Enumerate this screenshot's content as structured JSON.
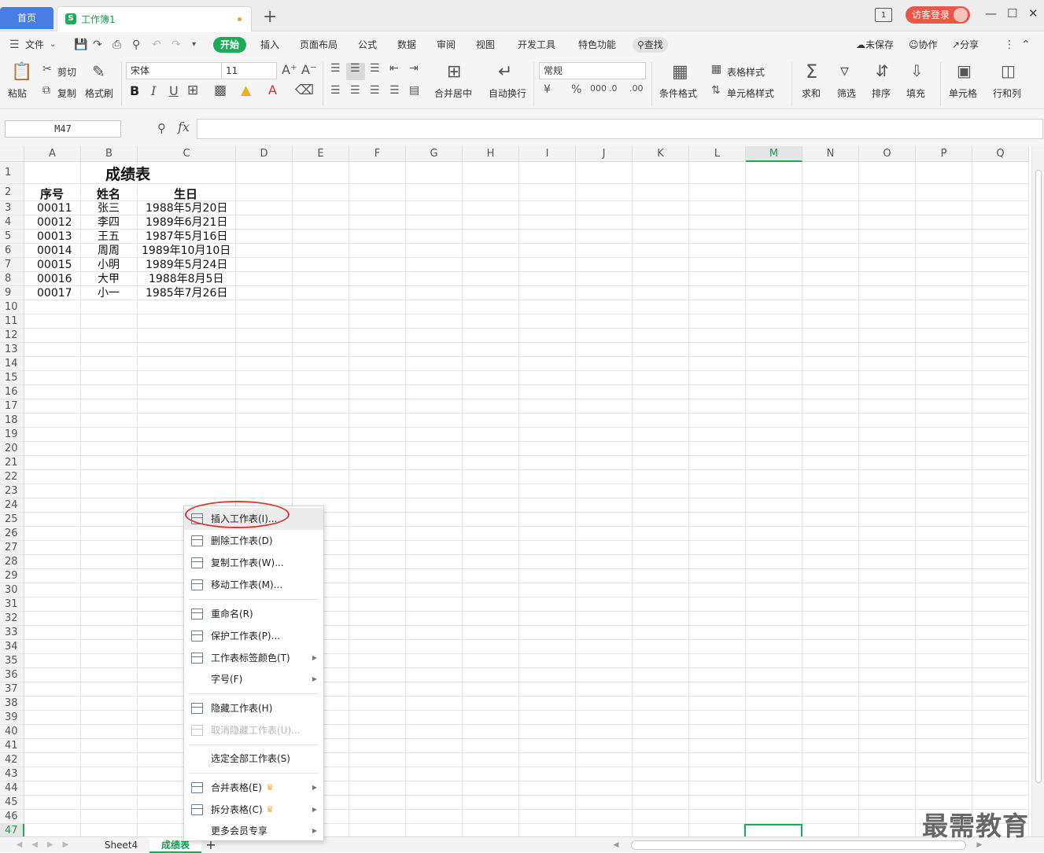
{
  "titlebar": {
    "home_tab": "首页",
    "doc_tab": "工作簿1",
    "login": "访客登录"
  },
  "menu": {
    "file": "文件",
    "tabs": [
      "开始",
      "插入",
      "页面布局",
      "公式",
      "数据",
      "审阅",
      "视图",
      "开发工具",
      "特色功能"
    ],
    "search": "查找",
    "unsaved": "未保存",
    "collab": "协作",
    "share": "分享"
  },
  "ribbon": {
    "paste": "粘贴",
    "cut": "剪切",
    "copy": "复制",
    "format_painter": "格式刷",
    "font_name": "宋体",
    "font_size": "11",
    "merge_center": "合并居中",
    "wrap_text": "自动换行",
    "number_format": "常规",
    "conditional_format": "条件格式",
    "table_style": "表格样式",
    "cell_style": "单元格样式",
    "sum": "求和",
    "filter": "筛选",
    "sort": "排序",
    "fill": "填充",
    "cell": "单元格",
    "row_col": "行和列"
  },
  "formula_bar": {
    "name_box": "M47",
    "fx": "fx",
    "formula": ""
  },
  "sheet": {
    "columns": [
      "A",
      "B",
      "C",
      "D",
      "E",
      "F",
      "G",
      "H",
      "I",
      "J",
      "K",
      "L",
      "M",
      "N",
      "O",
      "P",
      "Q"
    ],
    "selected_column": "M",
    "selected_row": "47",
    "title": "成绩表",
    "headers": [
      "序号",
      "姓名",
      "生日"
    ],
    "rows": [
      [
        "00011",
        "张三",
        "1988年5月20日"
      ],
      [
        "00012",
        "李四",
        "1989年6月21日"
      ],
      [
        "00013",
        "王五",
        "1987年5月16日"
      ],
      [
        "00014",
        "周周",
        "1989年10月10日"
      ],
      [
        "00015",
        "小明",
        "1989年5月24日"
      ],
      [
        "00016",
        "大甲",
        "1988年8月5日"
      ],
      [
        "00017",
        "小一",
        "1985年7月26日"
      ]
    ]
  },
  "sheet_tabs": [
    "Sheet4",
    "成绩表"
  ],
  "active_sheet": "成绩表",
  "context_menu": {
    "items": [
      {
        "label": "插入工作表(I)...",
        "icon": "insert-sheet-icon"
      },
      {
        "label": "删除工作表(D)",
        "icon": "delete-sheet-icon"
      },
      {
        "label": "复制工作表(W)...",
        "icon": "copy-sheet-icon"
      },
      {
        "label": "移动工作表(M)...",
        "icon": "move-sheet-icon"
      },
      {
        "label": "重命名(R)",
        "icon": "rename-icon"
      },
      {
        "label": "保护工作表(P)...",
        "icon": "protect-sheet-icon"
      },
      {
        "label": "工作表标签颜色(T)",
        "icon": "tab-color-icon"
      },
      {
        "label": "字号(F)",
        "icon": ""
      },
      {
        "label": "隐藏工作表(H)",
        "icon": "hide-sheet-icon"
      },
      {
        "label": "取消隐藏工作表(U)...",
        "icon": "unhide-sheet-icon"
      },
      {
        "label": "选定全部工作表(S)",
        "icon": ""
      },
      {
        "label": "合并表格(E)",
        "icon": "merge-table-icon"
      },
      {
        "label": "拆分表格(C)",
        "icon": "split-table-icon"
      },
      {
        "label": "更多会员专享",
        "icon": ""
      }
    ]
  },
  "watermark": "最需教育",
  "colors": {
    "accent": "#1faa5a",
    "home_tab": "#4a7de2",
    "login": "#e9574b",
    "highlight": "#d83a33"
  }
}
